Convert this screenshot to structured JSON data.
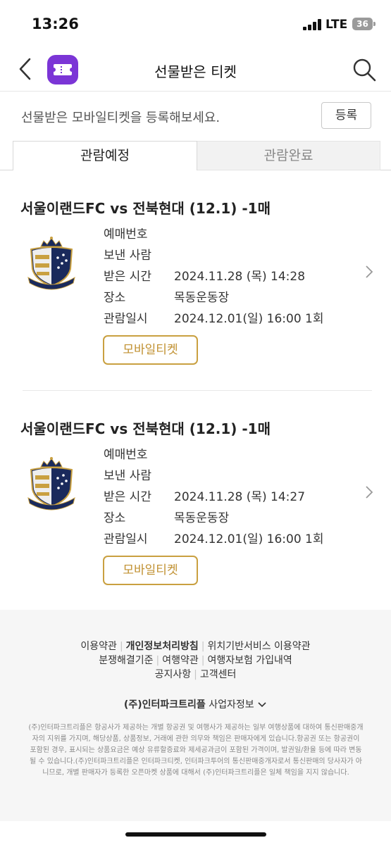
{
  "status_bar": {
    "time": "13:26",
    "network": "LTE",
    "battery": "36"
  },
  "nav": {
    "title": "선물받은 티켓",
    "back_icon": "chevron-left-icon",
    "app_icon": "ticket-app-icon",
    "search_icon": "search-icon"
  },
  "register": {
    "prompt": "선물받은 모바일티켓을 등록해보세요.",
    "button": "등록"
  },
  "tabs": [
    {
      "label": "관람예정",
      "active": true
    },
    {
      "label": "관람완료",
      "active": false
    }
  ],
  "tickets": [
    {
      "title": "서울이랜드FC vs 전북현대 (12.1) -1매",
      "rows": [
        {
          "label": "예매번호",
          "value": ""
        },
        {
          "label": "보낸 사람",
          "value": ""
        },
        {
          "label": "받은 시간",
          "value": "2024.11.28 (목) 14:28"
        },
        {
          "label": "장소",
          "value": "목동운동장"
        },
        {
          "label": "관람일시",
          "value": "2024.12.01(일) 16:00 1회"
        }
      ],
      "button": "모바일티켓"
    },
    {
      "title": "서울이랜드FC vs 전북현대 (12.1) -1매",
      "rows": [
        {
          "label": "예매번호",
          "value": ""
        },
        {
          "label": "보낸 사람",
          "value": ""
        },
        {
          "label": "받은 시간",
          "value": "2024.11.28 (목) 14:27"
        },
        {
          "label": "장소",
          "value": "목동운동장"
        },
        {
          "label": "관람일시",
          "value": "2024.12.01(일) 16:00 1회"
        }
      ],
      "button": "모바일티켓"
    }
  ],
  "footer": {
    "links_row1": [
      "이용약관",
      "개인정보처리방침",
      "위치기반서비스 이용약관"
    ],
    "links_row2": [
      "분쟁해결기준",
      "여행약관",
      "여행자보험 가입내역"
    ],
    "links_row3": [
      "공지사항",
      "고객센터"
    ],
    "company": "(주)인터파크트리플",
    "company_info": "사업자정보",
    "disclaimer": "(주)인터파크트리플은 항공사가 제공하는 개별 항공권 및 여행사가 제공하는 일부 여행상품에 대하여 통신판매중개자의 지위를 가지며, 해당상품, 상품정보, 거래에 관한 의무와 책임은 판매자에게 있습니다.항공권 또는 항공권이 포함된 경우, 표시되는 상품요금은 예상 유류할증료와 제세공과금이 포함된 가격이며, 발권일/환율 등에 따라 변동될 수 있습니다.(주)인터파크트리플은 인터파크티켓, 인터파크투어의 통신판매중개자로서 통신판매의 당사자가 아니므로, 개별 판매자가 등록한 오픈마켓 상품에 대해서 (주)인터파크트리플은 일체 책임을 지지 않습니다."
  },
  "colors": {
    "accent_gold": "#c9a040",
    "app_purple": "#7b35d6"
  }
}
